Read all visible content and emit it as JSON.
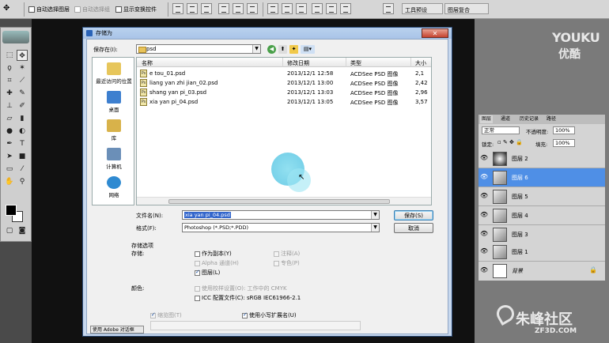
{
  "optbar": {
    "auto_select_layer": "自动选择图层",
    "auto_select_group": "自动选择组",
    "show_transform": "显示变换控件",
    "workspace_1": "工具预设",
    "workspace_2": "图层复合"
  },
  "youku": {
    "line1": "YOUKU",
    "line2": "优酷"
  },
  "layers_panel": {
    "tabs": [
      "图层",
      "通道",
      "历史记录",
      "路径"
    ],
    "blend_mode": "正常",
    "opacity_label": "不透明度:",
    "opacity_value": "100%",
    "lock_label": "锁定:",
    "fill_label": "填充:",
    "fill_value": "100%",
    "layers": [
      {
        "name": "图层 2",
        "selected": false
      },
      {
        "name": "图层 6",
        "selected": true
      },
      {
        "name": "图层 5",
        "selected": false
      },
      {
        "name": "图层 4",
        "selected": false
      },
      {
        "name": "图层 3",
        "selected": false
      },
      {
        "name": "图层 1",
        "selected": false
      },
      {
        "name": "背景",
        "selected": false
      }
    ]
  },
  "dialog": {
    "title": "存储为",
    "close": "✕",
    "save_in_label": "保存在(I):",
    "save_in_value": "psd",
    "places": [
      {
        "label": "最近访问的位置",
        "color": "#e7c65b"
      },
      {
        "label": "桌面",
        "color": "#3d7fcf"
      },
      {
        "label": "库",
        "color": "#d8b24a"
      },
      {
        "label": "计算机",
        "color": "#6b8fb8"
      },
      {
        "label": "网络",
        "color": "#2f8ad1"
      }
    ],
    "columns": [
      "名称",
      "修改日期",
      "类型",
      "大小"
    ],
    "files": [
      {
        "name": "e tou_01.psd",
        "date": "2013/12/1 12:58",
        "type": "ACDSee PSD 图像",
        "size": "2,1"
      },
      {
        "name": "liang yan zhi jian_02.psd",
        "date": "2013/12/1 13:00",
        "type": "ACDSee PSD 图像",
        "size": "2,42"
      },
      {
        "name": "shang yan pi_03.psd",
        "date": "2013/12/1 13:03",
        "type": "ACDSee PSD 图像",
        "size": "2,96"
      },
      {
        "name": "xia yan pi_04.psd",
        "date": "2013/12/1 13:05",
        "type": "ACDSee PSD 图像",
        "size": "3,57"
      }
    ],
    "filename_label": "文件名(N):",
    "filename_value": "xia yan pi_04.psd",
    "format_label": "格式(F):",
    "format_value": "Photoshop (*.PSD;*.PDD)",
    "save_button": "保存(S)",
    "cancel_button": "取消",
    "save_options_title": "存储选项",
    "save_label": "存储:",
    "as_copy": "作为副本(Y)",
    "alpha": "Alpha 通道(H)",
    "layers_opt": "图层(L)",
    "notes": "注释(A)",
    "spot": "专色(P)",
    "color_label": "颜色:",
    "use_proof": "使用校样设置(O): 工作中的 CMYK",
    "icc": "ICC 配置文件(C): sRGB IEC61966-2.1",
    "thumbnail": "缩览图(T)",
    "lowercase_ext": "使用小写扩展名(U)",
    "adobe_dialog": "使用 Adobe 对话框"
  },
  "watermark": {
    "line1": "朱峰社区",
    "line2": "ZF3D.COM"
  }
}
